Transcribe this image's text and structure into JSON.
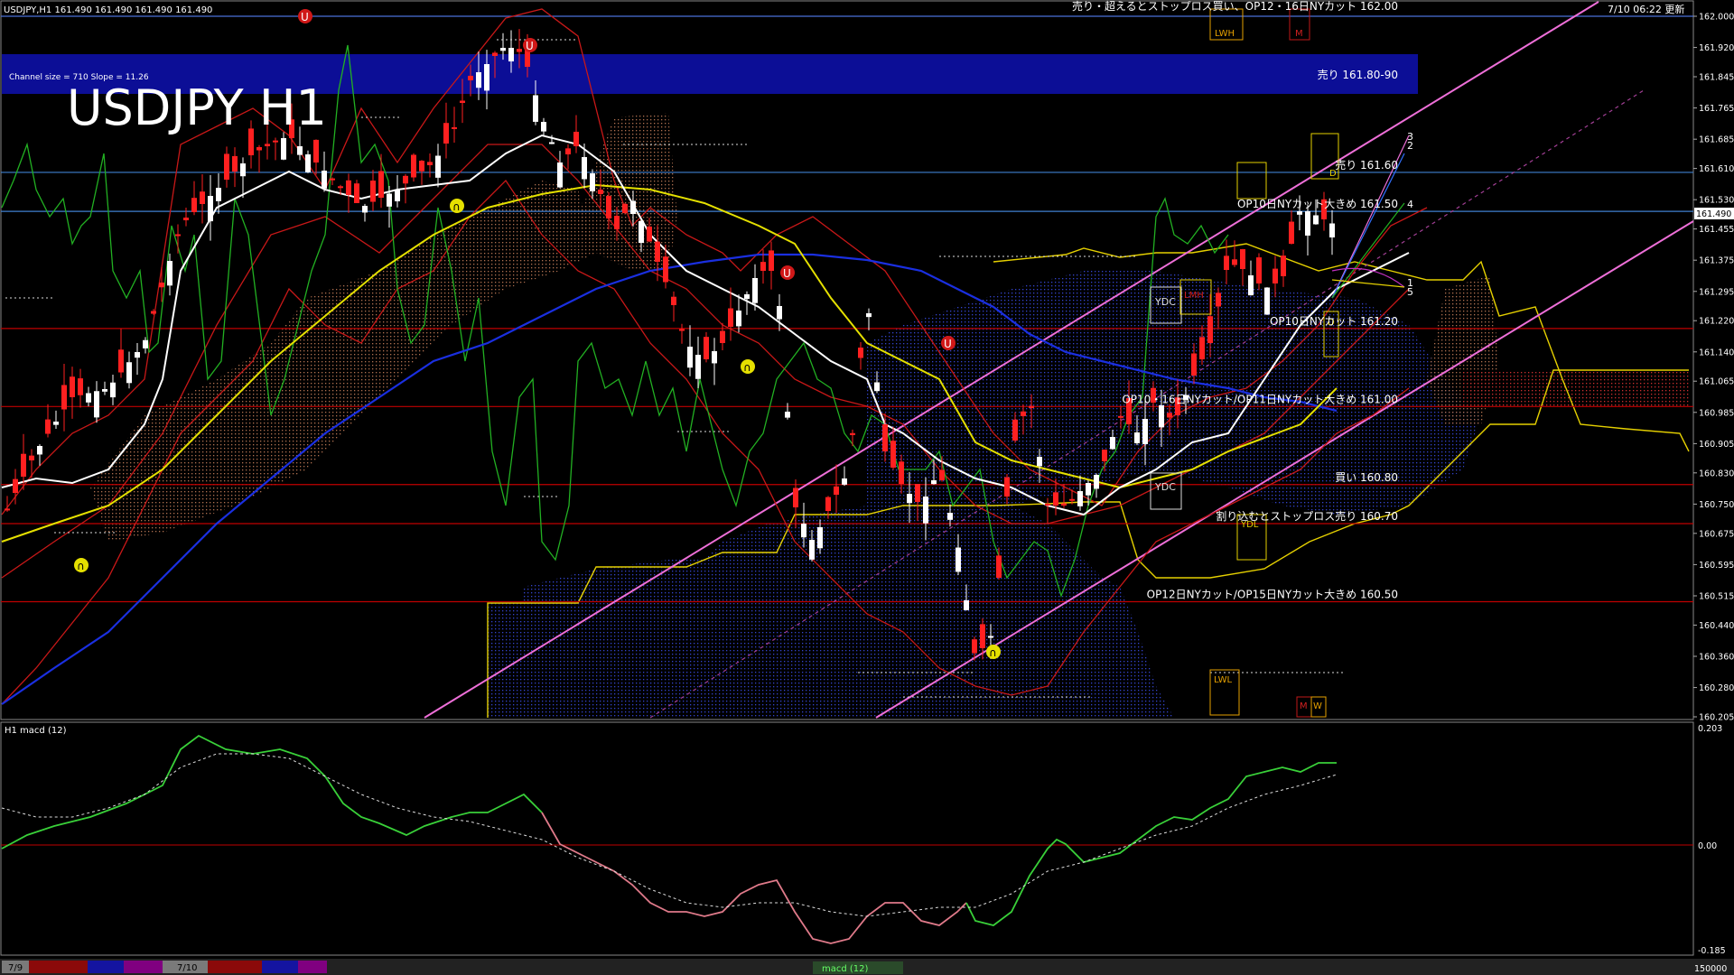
{
  "header": {
    "symbol_info": "USDJPY,H1  161.490 161.490 161.490 161.490",
    "timestamp": "7/10 06:22 更新",
    "big_title": "USDJPY H1",
    "channel_info": "Channel size = 710 Slope = 11.26"
  },
  "levels": [
    {
      "text": "売り・超えるとストップロス買い、OP12・16日NYカット 162.00",
      "price": 162.0,
      "color": "#4a6fd8"
    },
    {
      "text": "売り 161.80-90",
      "price": 161.85,
      "color": "#1b2aa8"
    },
    {
      "text": "売り 161.60",
      "price": 161.6,
      "color": "#3f7fd0"
    },
    {
      "text": "OP10日NYカット大きめ 161.50",
      "price": 161.5,
      "color": "#3f7fd0"
    },
    {
      "text": "OP10日NYカット 161.20",
      "price": 161.2,
      "color": "#c00000"
    },
    {
      "text": "OP10・16日NYカット/OP11日NYカット大きめ 161.00",
      "price": 161.0,
      "color": "#c00000"
    },
    {
      "text": "買い 160.80",
      "price": 160.8,
      "color": "#c00000"
    },
    {
      "text": "割り込むとストップロス売り 160.70",
      "price": 160.7,
      "color": "#c00000"
    },
    {
      "text": "OP12日NYカット/OP15日NYカット大きめ 160.50",
      "price": 160.5,
      "color": "#c00000"
    }
  ],
  "price_axis": {
    "ticks": [
      "162.000",
      "161.920",
      "161.845",
      "161.765",
      "161.685",
      "161.610",
      "161.530",
      "161.455",
      "161.375",
      "161.295",
      "161.220",
      "161.140",
      "161.065",
      "160.985",
      "160.905",
      "160.830",
      "160.750",
      "160.675",
      "160.595",
      "160.515",
      "160.440",
      "160.360",
      "160.280",
      "160.205"
    ],
    "current": "161.490"
  },
  "markers": {
    "ydc": "YDC",
    "ydl": "YDL",
    "lmh": "LMH",
    "lwh": "LWH",
    "lwl": "LWL",
    "m": "M",
    "w": "W",
    "d": "D"
  },
  "channel_labels": [
    "3",
    "2",
    "4",
    "1",
    "5"
  ],
  "macd": {
    "title": "H1  macd (12)",
    "max": "0.203",
    "zero": "0.00",
    "min": "-0.185"
  },
  "bottom_bar": {
    "date1": "7/9",
    "date2": "7/10",
    "tab_label": "macd (12)",
    "right_value": "150000"
  }
}
